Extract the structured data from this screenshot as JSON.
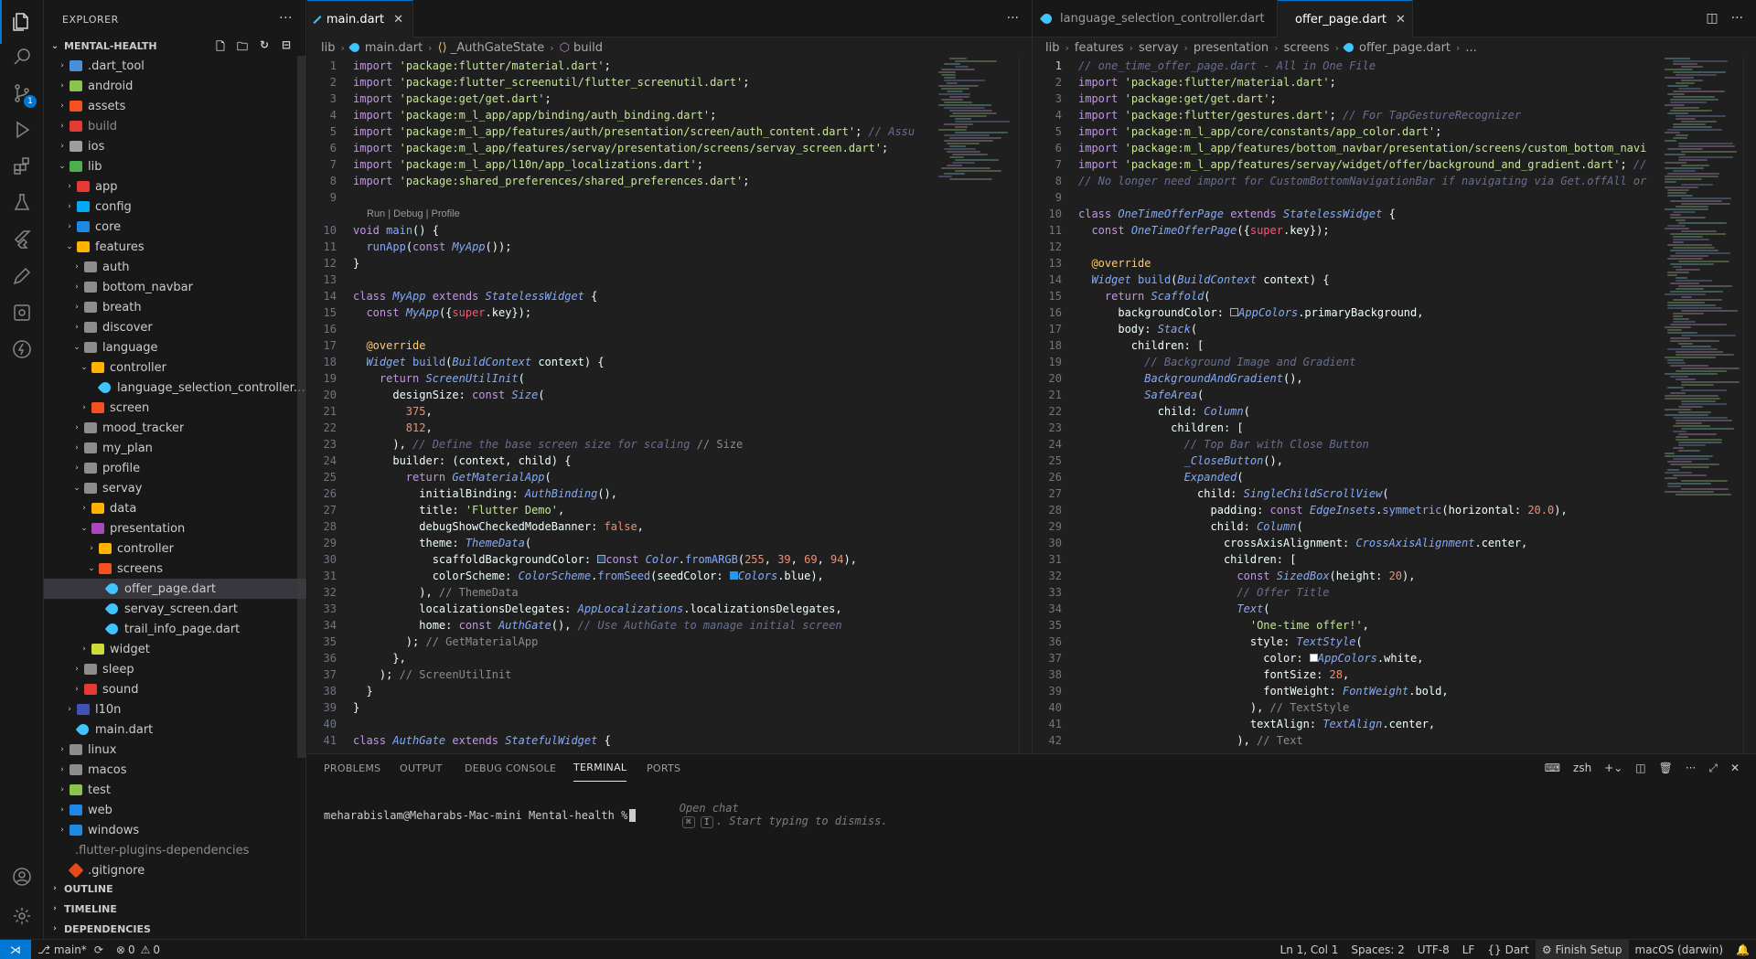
{
  "sidebar": {
    "title": "EXPLORER",
    "root": "MENTAL-HEALTH",
    "tree": [
      {
        "label": ".dart_tool",
        "color": "#4a8fd8",
        "depth": 1,
        "chev": "›",
        "dim": false
      },
      {
        "label": "android",
        "color": "#8bc34a",
        "depth": 1,
        "chev": "›"
      },
      {
        "label": "assets",
        "color": "#f4511e",
        "depth": 1,
        "chev": "›"
      },
      {
        "label": "build",
        "color": "#e53935",
        "depth": 1,
        "chev": "›",
        "dim": true
      },
      {
        "label": "ios",
        "color": "#9e9e9e",
        "depth": 1,
        "chev": "›"
      },
      {
        "label": "lib",
        "color": "#4caf50",
        "depth": 1,
        "chev": "⌄"
      },
      {
        "label": "app",
        "color": "#e53935",
        "depth": 2,
        "chev": "›"
      },
      {
        "label": "config",
        "color": "#03a9f4",
        "depth": 2,
        "chev": "›"
      },
      {
        "label": "core",
        "color": "#1e88e5",
        "depth": 2,
        "chev": "›"
      },
      {
        "label": "features",
        "color": "#ffb300",
        "depth": 2,
        "chev": "⌄"
      },
      {
        "label": "auth",
        "color": "#8d8d8d",
        "depth": 3,
        "chev": "›"
      },
      {
        "label": "bottom_navbar",
        "color": "#8d8d8d",
        "depth": 3,
        "chev": "›"
      },
      {
        "label": "breath",
        "color": "#8d8d8d",
        "depth": 3,
        "chev": "›"
      },
      {
        "label": "discover",
        "color": "#8d8d8d",
        "depth": 3,
        "chev": "›"
      },
      {
        "label": "language",
        "color": "#8d8d8d",
        "depth": 3,
        "chev": "⌄"
      },
      {
        "label": "controller",
        "color": "#ffb300",
        "depth": 4,
        "chev": "⌄"
      },
      {
        "label": "language_selection_controller....",
        "type": "dart",
        "depth": 5,
        "chev": ""
      },
      {
        "label": "screen",
        "color": "#f4511e",
        "depth": 4,
        "chev": "›"
      },
      {
        "label": "mood_tracker",
        "color": "#8d8d8d",
        "depth": 3,
        "chev": "›"
      },
      {
        "label": "my_plan",
        "color": "#8d8d8d",
        "depth": 3,
        "chev": "›"
      },
      {
        "label": "profile",
        "color": "#8d8d8d",
        "depth": 3,
        "chev": "›"
      },
      {
        "label": "servay",
        "color": "#8d8d8d",
        "depth": 3,
        "chev": "⌄"
      },
      {
        "label": "data",
        "color": "#ffb300",
        "depth": 4,
        "chev": "›"
      },
      {
        "label": "presentation",
        "color": "#ab47bc",
        "depth": 4,
        "chev": "⌄"
      },
      {
        "label": "controller",
        "color": "#ffb300",
        "depth": 5,
        "chev": "›"
      },
      {
        "label": "screens",
        "color": "#f4511e",
        "depth": 5,
        "chev": "⌄"
      },
      {
        "label": "offer_page.dart",
        "type": "dart",
        "depth": 6,
        "chev": "",
        "selected": true
      },
      {
        "label": "servay_screen.dart",
        "type": "dart",
        "depth": 6,
        "chev": ""
      },
      {
        "label": "trail_info_page.dart",
        "type": "dart",
        "depth": 6,
        "chev": ""
      },
      {
        "label": "widget",
        "color": "#cddc39",
        "depth": 4,
        "chev": "›"
      },
      {
        "label": "sleep",
        "color": "#8d8d8d",
        "depth": 3,
        "chev": "›"
      },
      {
        "label": "sound",
        "color": "#e53935",
        "depth": 3,
        "chev": "›"
      },
      {
        "label": "l10n",
        "color": "#3f51b5",
        "depth": 2,
        "chev": "›"
      },
      {
        "label": "main.dart",
        "type": "dart",
        "depth": 2,
        "chev": ""
      },
      {
        "label": "linux",
        "color": "#8d8d8d",
        "depth": 1,
        "chev": "›"
      },
      {
        "label": "macos",
        "color": "#8d8d8d",
        "depth": 1,
        "chev": "›"
      },
      {
        "label": "test",
        "color": "#8bc34a",
        "depth": 1,
        "chev": "›"
      },
      {
        "label": "web",
        "color": "#1e88e5",
        "depth": 1,
        "chev": "›"
      },
      {
        "label": "windows",
        "color": "#1e88e5",
        "depth": 1,
        "chev": "›"
      },
      {
        "label": ".flutter-plugins-dependencies",
        "type": "none",
        "depth": 1,
        "chev": "",
        "dim": true
      },
      {
        "label": ".gitignore",
        "type": "git",
        "depth": 1,
        "chev": ""
      }
    ],
    "sections": [
      "OUTLINE",
      "TIMELINE",
      "DEPENDENCIES"
    ]
  },
  "left_editor": {
    "tab": "main.dart",
    "breadcrumb": [
      "lib",
      "main.dart",
      "_AuthGateState",
      "build"
    ],
    "codelens": "Run | Debug | Profile",
    "line_numbers": [
      "1",
      "2",
      "3",
      "4",
      "5",
      "6",
      "7",
      "8",
      "9",
      "10",
      "11",
      "12",
      "13",
      "14",
      "15",
      "16",
      "17",
      "18",
      "19",
      "20",
      "21",
      "22",
      "23",
      "24",
      "25",
      "26",
      "27",
      "28",
      "29",
      "30",
      "31",
      "32",
      "33",
      "34",
      "35",
      "36",
      "37",
      "38",
      "39",
      "40",
      "41"
    ]
  },
  "right_editor": {
    "tabs": [
      "language_selection_controller.dart",
      "offer_page.dart"
    ],
    "breadcrumb": [
      "lib",
      "features",
      "servay",
      "presentation",
      "screens",
      "offer_page.dart",
      "..."
    ],
    "line_numbers": [
      "1",
      "2",
      "3",
      "4",
      "5",
      "6",
      "7",
      "8",
      "9",
      "10",
      "11",
      "12",
      "13",
      "14",
      "15",
      "16",
      "17",
      "18",
      "19",
      "20",
      "21",
      "22",
      "23",
      "24",
      "25",
      "26",
      "27",
      "28",
      "29",
      "30",
      "31",
      "32",
      "33",
      "34",
      "35",
      "36",
      "37",
      "38",
      "39",
      "40",
      "41",
      "42"
    ]
  },
  "panel": {
    "tabs": [
      "PROBLEMS",
      "OUTPUT",
      "DEBUG CONSOLE",
      "TERMINAL",
      "PORTS"
    ],
    "active_tab": "TERMINAL",
    "shell": "zsh",
    "prompt": "meharabislam@Meharabs-Mac-mini Mental-health %",
    "hint_pre": "Open chat",
    "hint_key1": "⌘",
    "hint_key2": "I",
    "hint_post": ". Start typing to dismiss."
  },
  "status": {
    "branch": "main*",
    "errors": "0",
    "warnings": "0",
    "position": "Ln 1, Col 1",
    "spaces": "Spaces: 2",
    "encoding": "UTF-8",
    "eol": "LF",
    "language": "Dart",
    "finish_setup": "Finish Setup",
    "platform": "macOS (darwin)"
  },
  "scm_badge": "1",
  "colors": {
    "accent": "#0078d4",
    "editor_bg": "#1f1f1f",
    "sidebar_bg": "#181818"
  }
}
